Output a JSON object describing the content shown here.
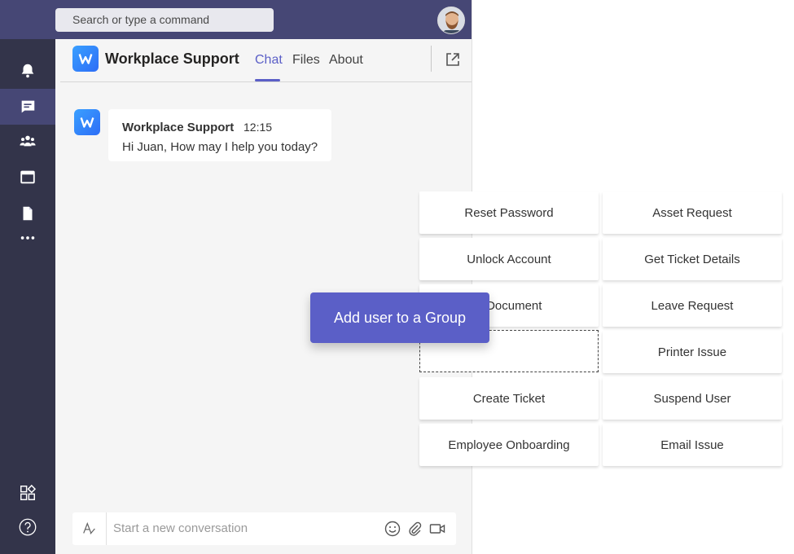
{
  "topbar": {
    "search_placeholder": "Search or type a command"
  },
  "rail": {
    "items": [
      "activity-icon",
      "chat-icon",
      "teams-icon",
      "calendar-icon",
      "files-icon",
      "more-icon",
      "apps-icon",
      "help-icon"
    ]
  },
  "header": {
    "title": "Workplace Support",
    "tabs": [
      "Chat",
      "Files",
      "About"
    ],
    "active_tab": "Chat"
  },
  "message": {
    "sender": "Workplace Support",
    "time": "12:15",
    "text": "Hi Juan, How may I help you today?"
  },
  "composer": {
    "placeholder": "Start a new conversation"
  },
  "cards": {
    "left": [
      "Reset Password",
      "Unlock Account",
      "h Document",
      "",
      "Create Ticket",
      "Employee Onboarding"
    ],
    "right": [
      "Asset Request",
      "Get Ticket Details",
      "Leave Request",
      "Printer Issue",
      "Suspend User",
      "Email Issue"
    ]
  },
  "dragging": {
    "label": "Add user to a Group"
  },
  "colors": {
    "topbar": "#464775",
    "rail": "#33344a",
    "accent": "#5b5fc7"
  }
}
